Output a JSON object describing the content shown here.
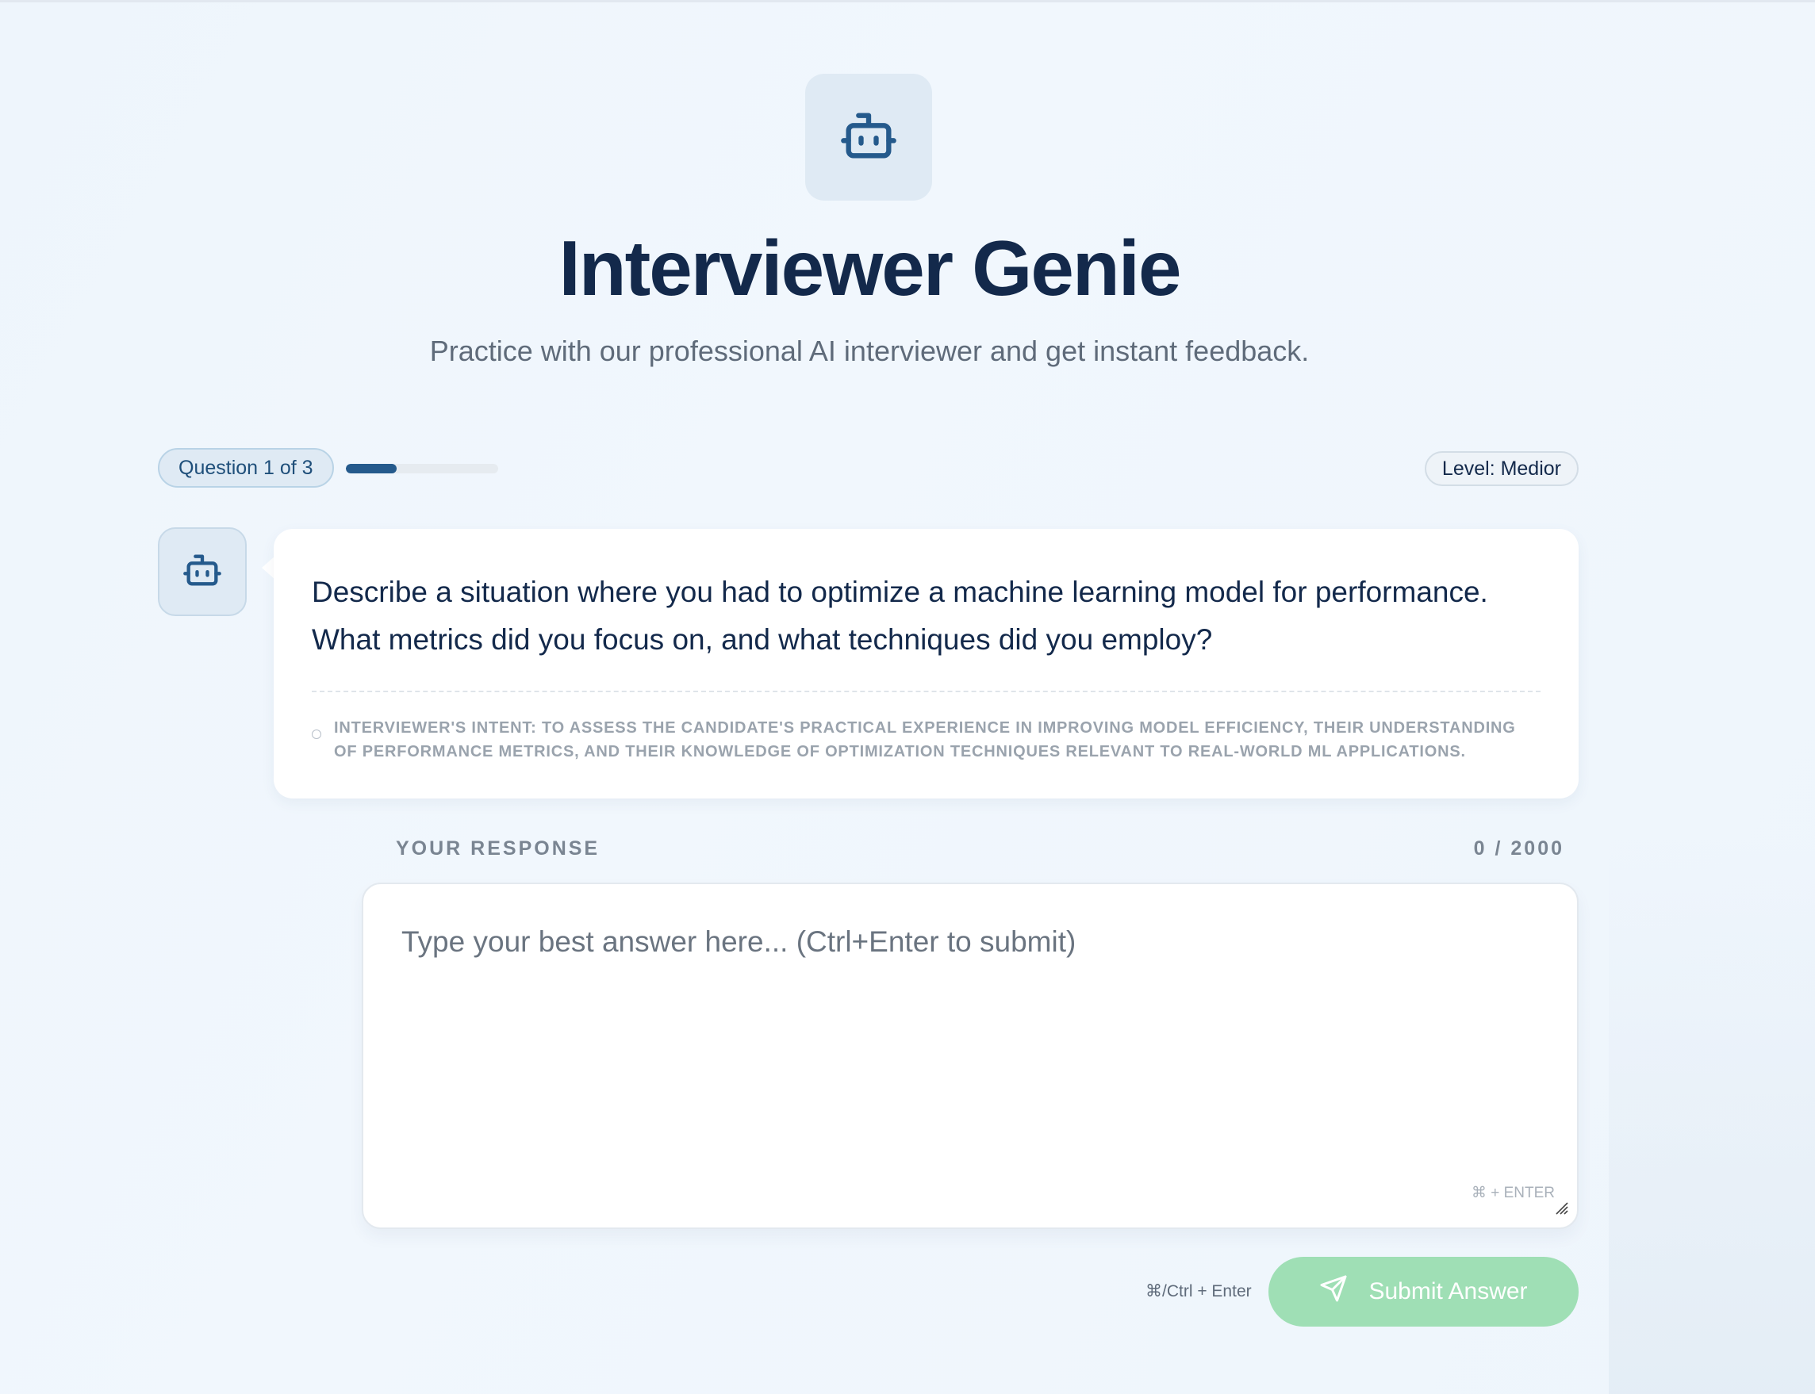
{
  "app": {
    "title": "Interviewer Genie",
    "subtitle": "Practice with our professional AI interviewer and get instant feedback."
  },
  "progress": {
    "label": "Question 1 of 3",
    "current": 1,
    "total": 3,
    "fill_fraction": 0.333
  },
  "level": {
    "label": "Level: Medior"
  },
  "question": {
    "text": "Describe a situation where you had to optimize a machine learning model for performance. What metrics did you focus on, and what techniques did you employ?",
    "intent": "Interviewer's intent: To assess the candidate's practical experience in improving model efficiency, their understanding of performance metrics, and their knowledge of optimization techniques relevant to real-world ML applications."
  },
  "response": {
    "label": "YOUR RESPONSE",
    "count": "0 / 2000",
    "value": "",
    "placeholder": "Type your best answer here... (Ctrl+Enter to submit)",
    "hint": "⌘ + ENTER"
  },
  "footer": {
    "shortcut": "⌘/Ctrl + Enter",
    "submit_label": "Submit Answer"
  },
  "colors": {
    "primary": "#255a8c",
    "title": "#13294b",
    "submit_bg": "#9fdfb5",
    "background": "#eef5fc"
  },
  "icons": [
    "bot-icon",
    "send-icon",
    "info-icon",
    "resize-handle-icon"
  ]
}
